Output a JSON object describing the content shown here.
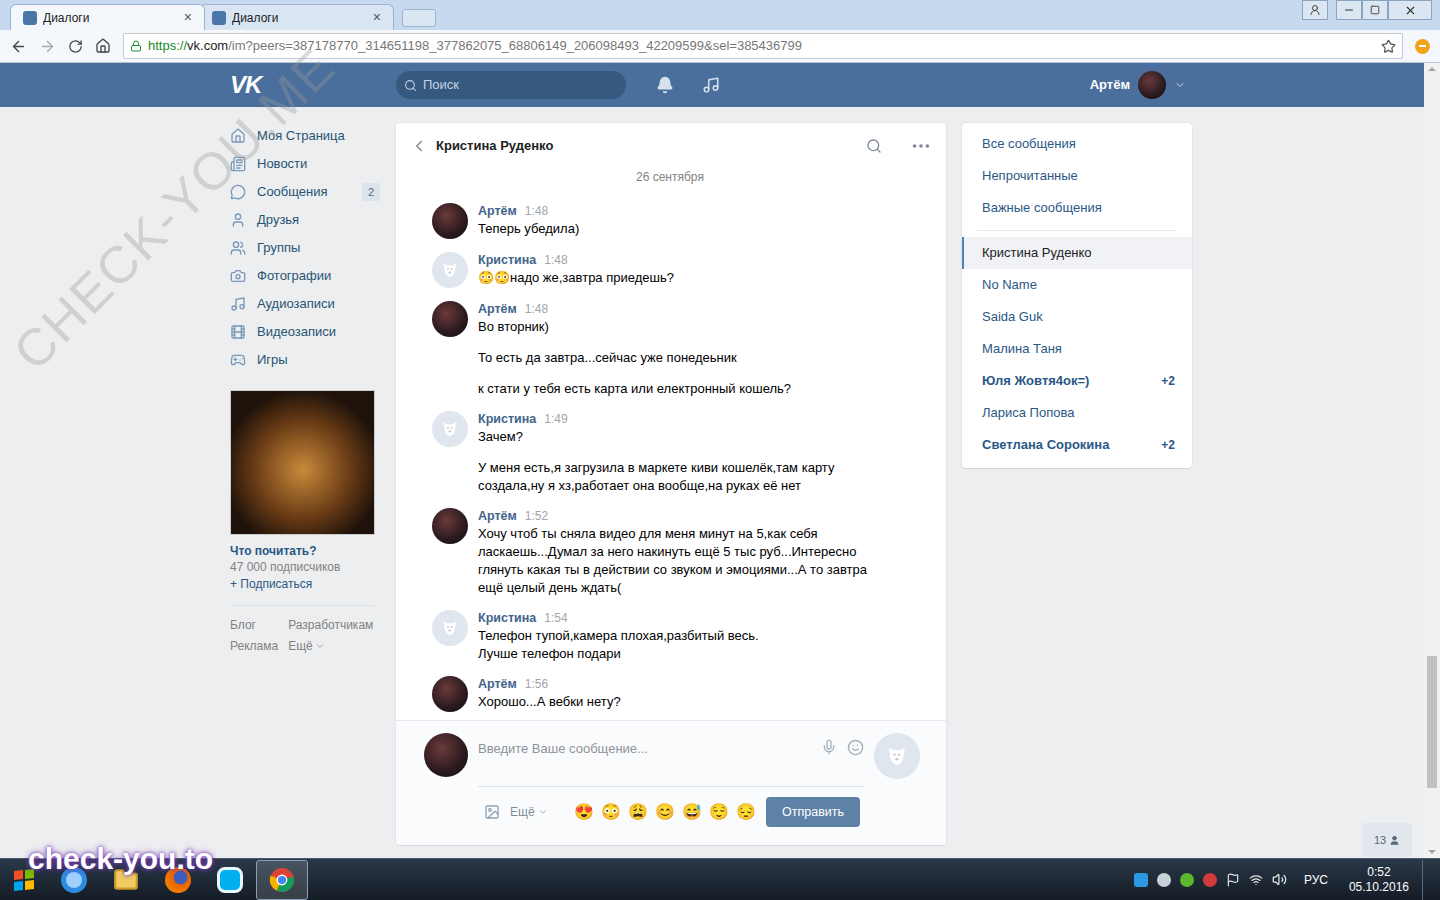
{
  "browser": {
    "tabs": [
      {
        "label": "Диалоги",
        "selected": true,
        "close": "×"
      },
      {
        "label": "Диалоги",
        "selected": false,
        "close": "×"
      }
    ],
    "url": {
      "scheme": "https://",
      "host": "vk.com",
      "rest": "/im?peers=387178770_314651198_377862075_68806149_206098493_42209599&sel=385436799"
    }
  },
  "header": {
    "logo": "VK",
    "search_placeholder": "Поиск",
    "user": "Артём"
  },
  "menu": [
    {
      "label": "Моя Страница",
      "badge": ""
    },
    {
      "label": "Новости",
      "badge": ""
    },
    {
      "label": "Сообщения",
      "badge": "2"
    },
    {
      "label": "Друзья",
      "badge": ""
    },
    {
      "label": "Группы",
      "badge": ""
    },
    {
      "label": "Фотографии",
      "badge": ""
    },
    {
      "label": "Аудиозаписи",
      "badge": ""
    },
    {
      "label": "Видеозаписи",
      "badge": ""
    },
    {
      "label": "Игры",
      "badge": ""
    }
  ],
  "promo": {
    "title": "Что почитать?",
    "subscribers": "47 000 подписчиков",
    "subscribe": "+ Подписаться"
  },
  "footer_links": [
    "Блог",
    "Разработчикам",
    "Реклама",
    "Ещё"
  ],
  "chat": {
    "title": "Кристина Руденко",
    "date": "26 сентября",
    "messages": [
      {
        "author": "Артём",
        "time": "1:48",
        "kind": "own",
        "paragraphs": [
          [
            "Теперь убедила)"
          ]
        ]
      },
      {
        "author": "Кристина",
        "time": "1:48",
        "kind": "other",
        "paragraphs": [
          [
            "😳😳надо же,завтра приедешь?"
          ]
        ]
      },
      {
        "author": "Артём",
        "time": "1:48",
        "kind": "own",
        "paragraphs": [
          [
            "Во вторник)"
          ],
          [
            "То есть да завтра...сейчас уже понедеьник"
          ],
          [
            "к стати у тебя есть карта или електронный кошель?"
          ]
        ]
      },
      {
        "author": "Кристина",
        "time": "1:49",
        "kind": "other",
        "paragraphs": [
          [
            "Зачем?"
          ],
          [
            "У меня есть,я загрузила в маркете киви кошелёк,там карту создала,ну я хз,работает она вообще,на руках её нет"
          ]
        ]
      },
      {
        "author": "Артём",
        "time": "1:52",
        "kind": "own",
        "paragraphs": [
          [
            "Хочу чтоб ты сняла видео для меня минут на 5,как себя ласкаешь...Думал за него накинуть ещё 5 тыс руб...Интересно глянуть какая ты в действии со звуком и эмоциями...А то завтра ещё целый день ждать("
          ]
        ]
      },
      {
        "author": "Кристина",
        "time": "1:54",
        "kind": "other",
        "paragraphs": [
          [
            "Телефон тупой,камера плохая,разбитый весь.",
            "Лучше телефон подари"
          ]
        ]
      },
      {
        "author": "Артём",
        "time": "1:56",
        "kind": "own",
        "paragraphs": [
          [
            "Хорошо...А вебки нету?"
          ]
        ]
      }
    ]
  },
  "composer": {
    "placeholder": "Введите Ваше сообщение...",
    "more": "Ещё",
    "emojis": [
      "😍",
      "😳",
      "😩",
      "😊",
      "😅",
      "😌",
      "😔"
    ],
    "send": "Отправить"
  },
  "filters": [
    {
      "label": "Все сообщения"
    },
    {
      "label": "Непрочитанные"
    },
    {
      "label": "Важные сообщения"
    }
  ],
  "conversations": [
    {
      "name": "Кристина Руденко",
      "selected": true,
      "unread": false,
      "count": ""
    },
    {
      "name": "No Name",
      "selected": false,
      "unread": false,
      "count": ""
    },
    {
      "name": "Saida Guk",
      "selected": false,
      "unread": false,
      "count": ""
    },
    {
      "name": "Малина Таня",
      "selected": false,
      "unread": false,
      "count": ""
    },
    {
      "name": "Юля Жовтя4ок=)",
      "selected": false,
      "unread": true,
      "count": "+2"
    },
    {
      "name": "Лариса Попова",
      "selected": false,
      "unread": false,
      "count": ""
    },
    {
      "name": "Светлана Сорокина",
      "selected": false,
      "unread": true,
      "count": "+2"
    }
  ],
  "online_button": {
    "count": "13"
  },
  "taskbar": {
    "lang": "РУС",
    "time": "0:52",
    "date": "05.10.2016"
  },
  "watermarks": {
    "diagonal": "CHECK-YOU.ME",
    "corner": "check-you.to"
  }
}
